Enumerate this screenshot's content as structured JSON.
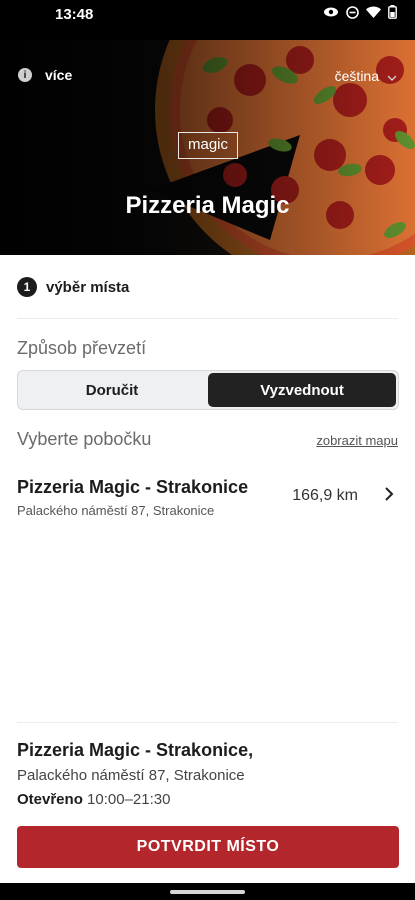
{
  "status_bar": {
    "time": "13:48"
  },
  "header": {
    "more_label": "více",
    "language": "čeština",
    "logo_text": "magic",
    "title": "Pizzeria Magic"
  },
  "step": {
    "number": "1",
    "label": "výběr místa"
  },
  "pickup": {
    "label": "Způsob převzetí",
    "options": [
      "Doručit",
      "Vyzvednout"
    ],
    "selected": "Vyzvednout"
  },
  "branches": {
    "label": "Vyberte pobočku",
    "show_map": "zobrazit mapu",
    "items": [
      {
        "name": "Pizzeria Magic - Strakonice",
        "address": "Palackého náměstí 87, Strakonice",
        "distance": "166,9 km"
      }
    ]
  },
  "summary": {
    "name": "Pizzeria Magic - Strakonice,",
    "address": "Palackého náměstí 87, Strakonice",
    "open_label": "Otevřeno",
    "hours": "10:00–21:30"
  },
  "confirm_label": "POTVRDIT MÍSTO",
  "colors": {
    "accent": "#b3262b",
    "dark": "#222222"
  }
}
